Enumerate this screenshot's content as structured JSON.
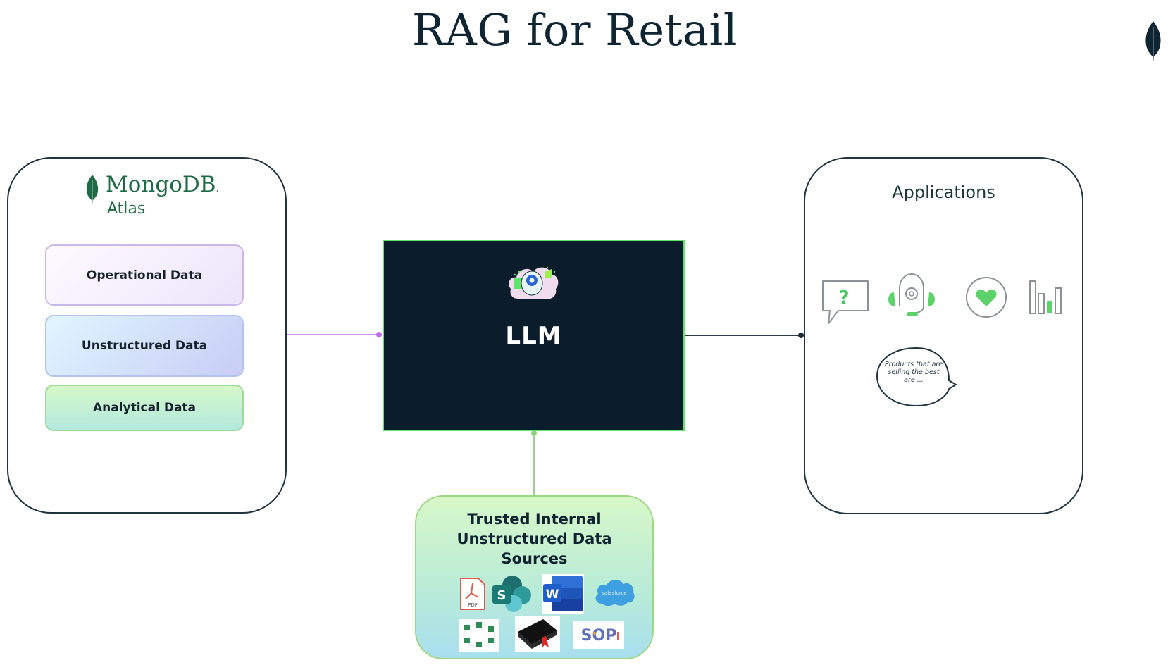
{
  "title": "RAG for Retail",
  "icons": {
    "corner": "mongodb-leaf-icon"
  },
  "left_panel": {
    "brand_name": "MongoDB",
    "brand_mark": ".",
    "product": "Atlas",
    "data_boxes": [
      {
        "label": "Operational Data"
      },
      {
        "label": "Unstructured Data"
      },
      {
        "label": "Analytical Data"
      }
    ]
  },
  "llm": {
    "label": "LLM",
    "icon": "ai-brain-gear-icon"
  },
  "applications": {
    "title": "Applications",
    "icons": [
      "question-chat-icon",
      "support-headset-icon",
      "heart-loyalty-icon",
      "bar-chart-icon"
    ],
    "speech_bubble": "Products that are selling the best are ..."
  },
  "sources": {
    "title_line1": "Trusted Internal",
    "title_line2": "Unstructured Data",
    "title_line3": "Sources",
    "icons": [
      "pdf-icon",
      "sharepoint-icon",
      "word-icon",
      "salesforce-icon",
      "network-icon",
      "manual-book-icon",
      "sop-icon"
    ],
    "salesforce_label": "salesforce",
    "sop_label": "SOP",
    "pdf_label": "PDF",
    "sharepoint_letter": "S",
    "word_letter": "W"
  },
  "colors": {
    "brand_green": "#1e6a45",
    "llm_bg": "#0b1d2a",
    "llm_border": "#5ee66c",
    "accent_purple": "#d38cf0",
    "icon_green": "#5dd26a"
  }
}
